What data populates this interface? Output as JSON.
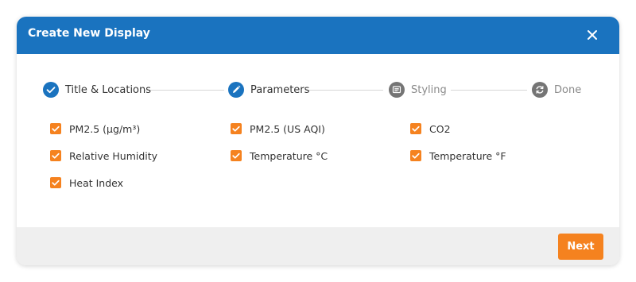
{
  "dialog": {
    "title": "Create New Display"
  },
  "steps": [
    {
      "label": "Title & Locations",
      "state": "done",
      "icon": "check-icon"
    },
    {
      "label": "Parameters",
      "state": "active",
      "icon": "pencil-icon"
    },
    {
      "label": "Styling",
      "state": "inactive",
      "icon": "message-icon"
    },
    {
      "label": "Done",
      "state": "inactive",
      "icon": "refresh-icon"
    }
  ],
  "parameters": [
    {
      "label": "PM2.5 (µg/m³)",
      "checked": true
    },
    {
      "label": "PM2.5 (US AQI)",
      "checked": true
    },
    {
      "label": "CO2",
      "checked": true
    },
    {
      "label": "Relative Humidity",
      "checked": true
    },
    {
      "label": "Temperature °C",
      "checked": true
    },
    {
      "label": "Temperature °F",
      "checked": true
    },
    {
      "label": "Heat Index",
      "checked": true
    }
  ],
  "footer": {
    "next_label": "Next"
  },
  "colors": {
    "header": "#1a73bf",
    "accent": "#f5821f",
    "step_inactive": "#757575"
  }
}
